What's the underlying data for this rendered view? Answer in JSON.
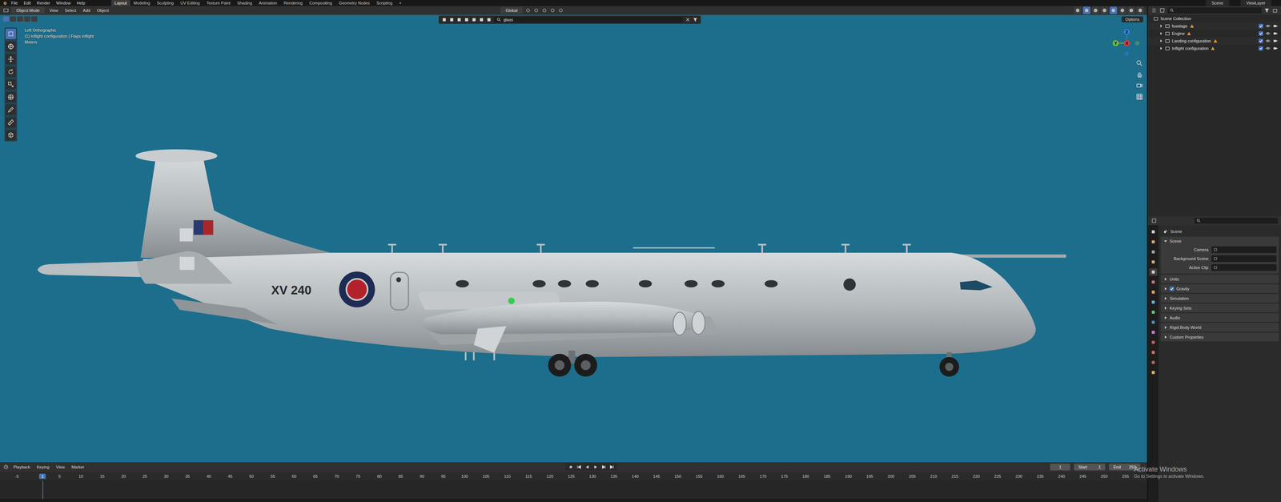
{
  "topbar": {
    "menus": [
      "File",
      "Edit",
      "Render",
      "Window",
      "Help"
    ],
    "workspaces": [
      {
        "label": "Layout",
        "selected": true
      },
      {
        "label": "Modeling",
        "selected": false
      },
      {
        "label": "Sculpting",
        "selected": false
      },
      {
        "label": "UV Editing",
        "selected": false
      },
      {
        "label": "Texture Paint",
        "selected": false
      },
      {
        "label": "Shading",
        "selected": false
      },
      {
        "label": "Animation",
        "selected": false
      },
      {
        "label": "Rendering",
        "selected": false
      },
      {
        "label": "Compositing",
        "selected": false
      },
      {
        "label": "Geometry Nodes",
        "selected": false
      },
      {
        "label": "Scripting",
        "selected": false
      }
    ],
    "add_workspace": "+",
    "scene": "Scene",
    "view_layer": "ViewLayer"
  },
  "viewport": {
    "mode": "Object Mode",
    "menus": [
      "View",
      "Select",
      "Add",
      "Object"
    ],
    "orientation": "Global",
    "filter": "glass",
    "options": "Options",
    "overlay": [
      "Left Orthographic",
      "(1) Inflight configuration | Flaps inflight",
      "Meters"
    ],
    "axes": [
      {
        "label": "Z",
        "color": "#2f83e0"
      },
      {
        "label": "Y",
        "color": "#6fbf3b"
      },
      {
        "label": "X",
        "color": "#e5383f"
      }
    ],
    "tools": [
      {
        "selected": true
      },
      {
        "selected": false
      },
      {
        "selected": false
      },
      {
        "selected": false
      },
      {
        "selected": false
      },
      {
        "selected": false
      },
      {
        "selected": false
      },
      {
        "selected": false
      },
      {
        "selected": false
      }
    ],
    "aircraft": {
      "marking": "XV 240"
    }
  },
  "outliner": {
    "root": "Scene Collection",
    "items": [
      {
        "name": "fuselage",
        "expanded": false,
        "checked": true
      },
      {
        "name": "Engine",
        "expanded": false,
        "checked": true
      },
      {
        "name": "Landing configuration",
        "expanded": false,
        "checked": true
      },
      {
        "name": "Inflight configuration",
        "expanded": false,
        "checked": true
      }
    ]
  },
  "properties": {
    "title": "Scene",
    "tabs": [
      {
        "selected": false
      },
      {
        "selected": false
      },
      {
        "selected": false
      },
      {
        "selected": false
      },
      {
        "selected": true
      },
      {
        "selected": false
      },
      {
        "selected": false
      },
      {
        "selected": false
      },
      {
        "selected": false
      },
      {
        "selected": false
      },
      {
        "selected": false
      },
      {
        "selected": false
      },
      {
        "selected": false
      },
      {
        "selected": false
      },
      {
        "selected": false
      }
    ],
    "section": {
      "label": "Scene",
      "expanded": true,
      "fields": [
        {
          "label": "Camera"
        },
        {
          "label": "Background Scene"
        },
        {
          "label": "Active Clip"
        }
      ]
    },
    "panels": [
      {
        "label": "Units",
        "kind": "plain",
        "expanded": false
      },
      {
        "label": "Gravity",
        "kind": "checkbox",
        "checked": true,
        "expanded": false
      },
      {
        "label": "Simulation",
        "kind": "plain",
        "expanded": false
      },
      {
        "label": "Keying Sets",
        "kind": "plain",
        "expanded": false
      },
      {
        "label": "Audio",
        "kind": "plain",
        "expanded": false
      },
      {
        "label": "Rigid Body World",
        "kind": "plain",
        "expanded": false
      },
      {
        "label": "Custom Properties",
        "kind": "plain",
        "expanded": false
      }
    ]
  },
  "timeline": {
    "menus": [
      "Playback",
      "Keying",
      "View",
      "Marker"
    ],
    "frame": "1",
    "start_label": "Start",
    "start": "1",
    "end_label": "End",
    "end": "250",
    "current": "1",
    "ruler": [
      "-5",
      "1",
      "5",
      "10",
      "15",
      "20",
      "25",
      "30",
      "35",
      "40",
      "45",
      "50",
      "55",
      "60",
      "65",
      "70",
      "75",
      "80",
      "85",
      "90",
      "95",
      "100",
      "105",
      "110",
      "115",
      "120",
      "125",
      "130",
      "135",
      "140",
      "145",
      "150",
      "155",
      "160",
      "165",
      "170",
      "175",
      "180",
      "185",
      "190",
      "195",
      "200",
      "205",
      "210",
      "215",
      "220",
      "225",
      "230",
      "235",
      "240",
      "245",
      "250",
      "255"
    ]
  },
  "watermark": {
    "title": "Activate Windows",
    "subtitle": "Go to Settings to activate Windows."
  }
}
